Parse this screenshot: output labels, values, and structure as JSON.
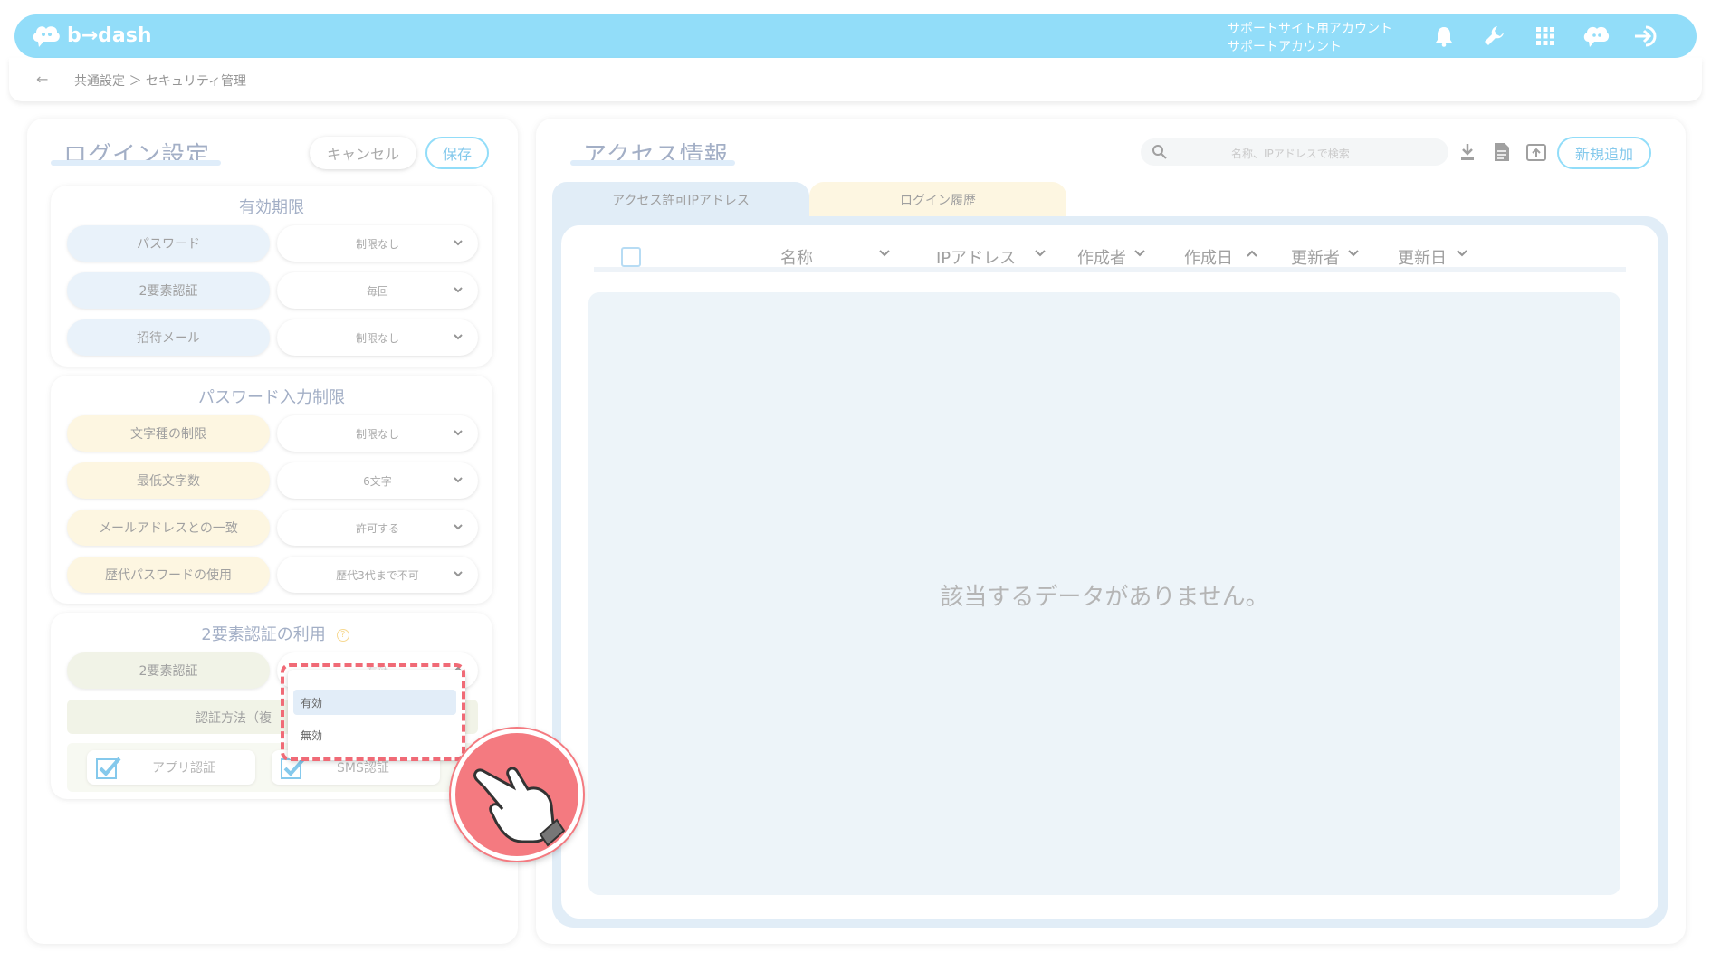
{
  "header": {
    "logo_text": "b→dash",
    "account_line1": "サポートサイト用アカウント",
    "account_line2": "サポートアカウント",
    "icons": [
      "bell-icon",
      "wrench-icon",
      "grid-icon",
      "chat-icon",
      "logout-icon"
    ],
    "accent_color": "#4fc8f5"
  },
  "breadcrumb": {
    "back": "←",
    "path": "共通設定 ＞ セキュリティ管理"
  },
  "login_settings": {
    "title": "ログイン設定",
    "cancel_label": "キャンセル",
    "save_label": "保存",
    "expiry": {
      "title": "有効期限",
      "rows": [
        {
          "label": "パスワード",
          "value": "制限なし"
        },
        {
          "label": "2要素認証",
          "value": "毎回"
        },
        {
          "label": "招待メール",
          "value": "制限なし"
        }
      ]
    },
    "password_rules": {
      "title": "パスワード入力制限",
      "rows": [
        {
          "label": "文字種の制限",
          "value": "制限なし"
        },
        {
          "label": "最低文字数",
          "value": "6文字"
        },
        {
          "label": "メールアドレスとの一致",
          "value": "許可する"
        },
        {
          "label": "歴代パスワードの使用",
          "value": "歴代3代まで不可"
        }
      ]
    },
    "two_factor": {
      "title": "2要素認証の利用",
      "row_label": "2要素認証",
      "row_value": "有効",
      "method_label": "認証方法（複",
      "app_auth": "アプリ認証",
      "sms_auth": "SMS認証",
      "options": [
        "有効",
        "無効"
      ]
    }
  },
  "access_info": {
    "title": "アクセス情報",
    "search_placeholder": "名称、IPアドレスで検索",
    "new_button": "新規追加",
    "tabs": [
      "アクセス許可IPアドレス",
      "ログイン履歴"
    ],
    "columns": [
      "名称",
      "IPアドレス",
      "作成者",
      "作成日",
      "更新者",
      "更新日"
    ],
    "empty_message": "該当するデータがありません。"
  }
}
